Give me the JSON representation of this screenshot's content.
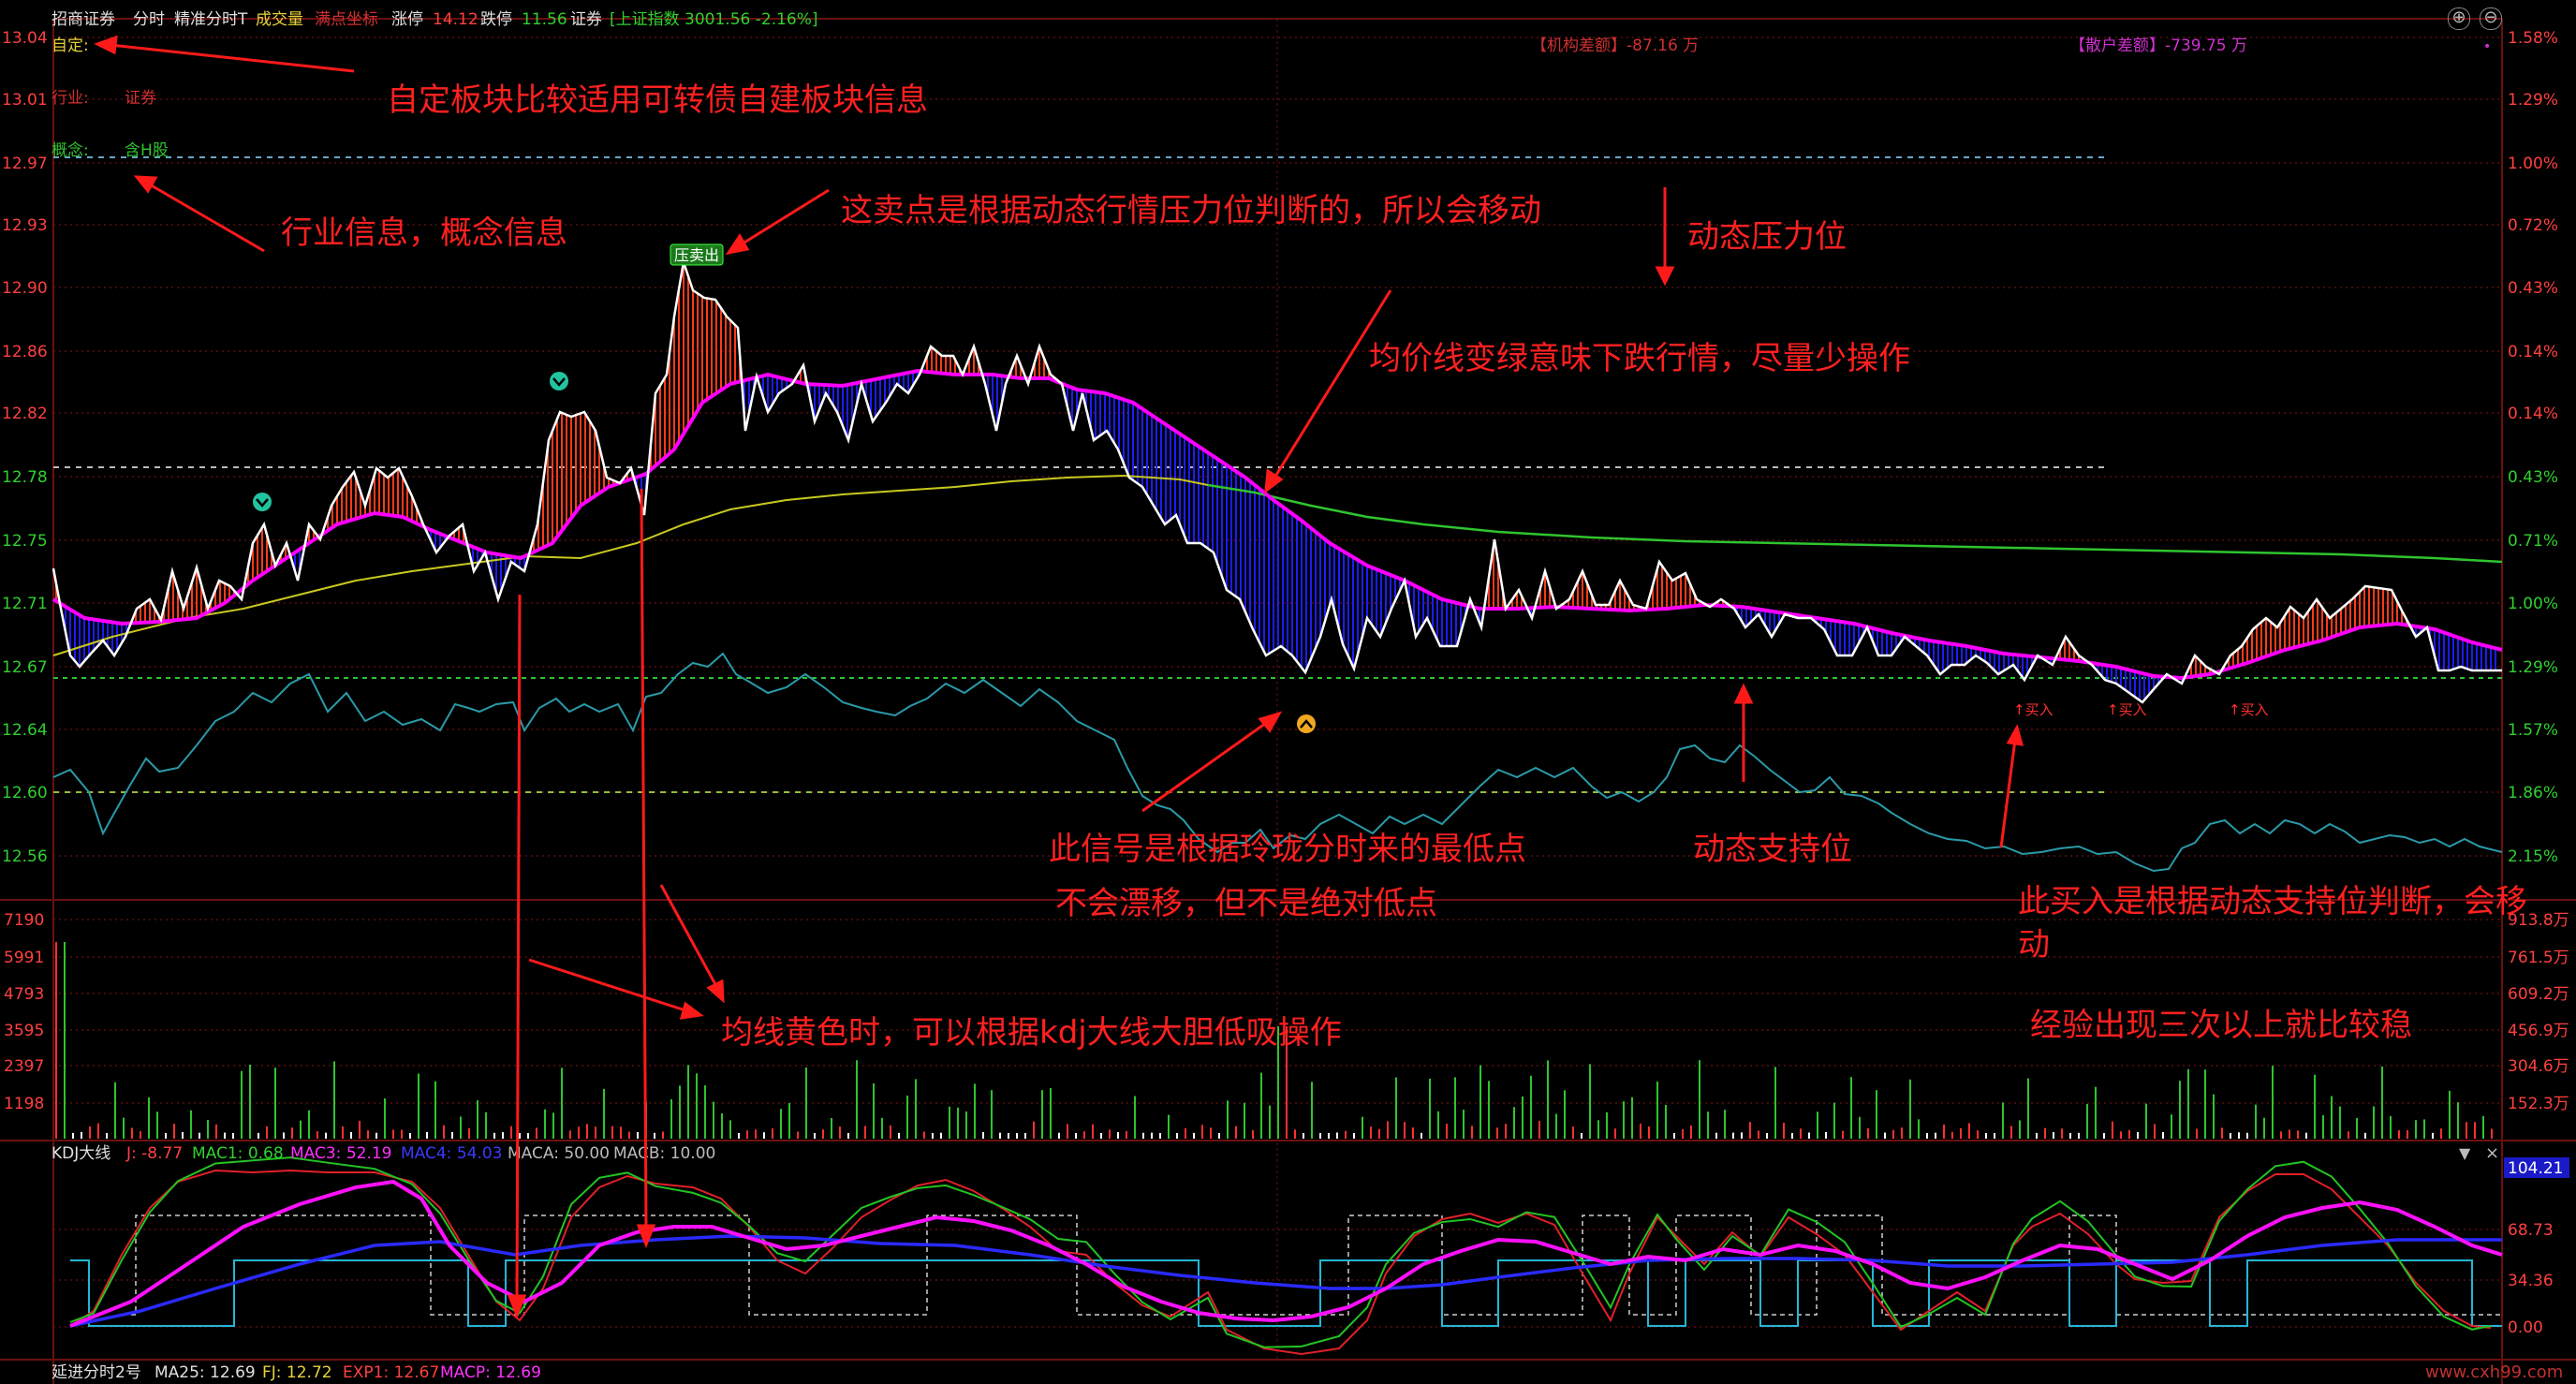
{
  "header": {
    "stock_name": "招商证券",
    "mode1": "分时",
    "mode2": "精准分时T",
    "item_volume": "成交量",
    "item_fullpoint": "满点坐标",
    "limit_up_label": "涨停",
    "limit_up_value": "14.12",
    "limit_down_label": "跌停",
    "limit_down_value": "11.56",
    "sector_name": "证券",
    "index_text": "[上证指数 3001.56 -2.16%]"
  },
  "info": {
    "custom_label": "自定:",
    "industry_label": "行业:",
    "industry_value": "证券",
    "concept_label": "概念:",
    "concept_value": "含H股",
    "institution": "【机构差额】-87.16 万",
    "retail": "【散户差额】-739.75 万"
  },
  "price_axis": {
    "left": [
      "13.04",
      "13.01",
      "12.97",
      "12.93",
      "12.90",
      "12.86",
      "12.82",
      "12.78",
      "12.75",
      "12.71",
      "12.67",
      "12.64",
      "12.60",
      "12.56"
    ],
    "right": [
      "1.58%",
      "1.29%",
      "1.00%",
      "0.72%",
      "0.43%",
      "0.14%",
      "0.14%",
      "0.43%",
      "0.71%",
      "1.00%",
      "1.29%",
      "1.57%",
      "1.86%",
      "2.15%"
    ]
  },
  "volume_axis": {
    "left": [
      "7190",
      "5991",
      "4793",
      "3595",
      "2397",
      "1198"
    ],
    "right": [
      "913.8万",
      "761.5万",
      "609.2万",
      "456.9万",
      "304.6万",
      "152.3万"
    ]
  },
  "kdj": {
    "title": "KDJ大线",
    "j": "J: -8.77",
    "mac1": "MAC1: 0.68",
    "mac3": "MAC3: 52.19",
    "mac4": "MAC4: 54.03",
    "maca": "MACA: 50.00",
    "macb": "MACB: 10.00",
    "axis": [
      "104.21",
      "68.73",
      "34.36",
      "0.00"
    ]
  },
  "footer": {
    "name": "延进分时2号",
    "ma25": "MA25: 12.69",
    "fj": "FJ: 12.72",
    "exp1": "EXP1: 12.67",
    "macp": "MACP: 12.69"
  },
  "signals": {
    "sell": "压卖出",
    "buy": "买入"
  },
  "annotations": {
    "a1": "自定板块比较适用可转债自建板块信息",
    "a2": "行业信息，概念信息",
    "a3": "这卖点是根据动态行情压力位判断的，所以会移动",
    "a4": "动态压力位",
    "a5": "均价线变绿意味下跌行情，尽量少操作",
    "a6": "此信号是根据玲珑分时来的最低点",
    "a7": "不会漂移，但不是绝对低点",
    "a8": "动态支持位",
    "a9_1": "此买入是根据动态支持位判断，会移",
    "a9_2": "动",
    "a10": "均线黄色时，可以根据kdj大线大胆低吸操作",
    "a11": "经验出现三次以上就比较稳"
  },
  "watermark": "www.cxh99.com",
  "colors": {
    "price_line": "#ffffff",
    "avg_line": "#ff00ff",
    "up_fill": "#ff3b1a",
    "down_fill": "#1c1cff",
    "ma_yellow": "#c8c820",
    "ma_green": "#2fc42f",
    "cyan_line": "#2a9aa8",
    "annotation": "#ff2020"
  }
}
